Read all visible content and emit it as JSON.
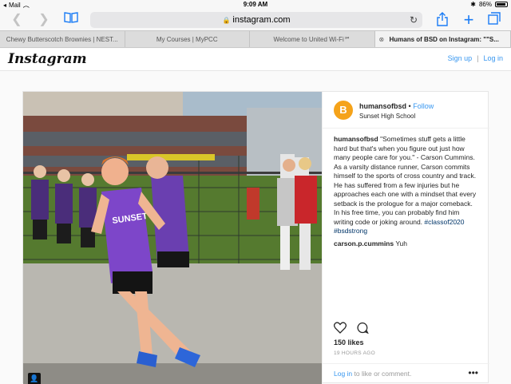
{
  "status": {
    "carrier": "Mail",
    "time": "9:09 AM",
    "battery": "86%"
  },
  "browser": {
    "url": "instagram.com",
    "tabs": [
      {
        "label": "Chewy Butterscotch Brownies | NEST..."
      },
      {
        "label": "My Courses | MyPCC"
      },
      {
        "label": "Welcome to United Wi-Fi℠"
      },
      {
        "label": "Humans of BSD on Instagram: \"\"S..."
      }
    ]
  },
  "header": {
    "logo": "Instagram",
    "signup": "Sign up",
    "separator": "|",
    "login": "Log in"
  },
  "post": {
    "username": "humansofbsd",
    "bullet": "•",
    "follow": "Follow",
    "location": "Sunset High School",
    "caption_user": "humansofbsd",
    "caption_text": " \"Sometimes stuff gets a little hard but that's when you figure out just how many people care for you.\" - Carson Cummins. As a varsity distance runner, Carson commits himself to the sports of cross country and track. He has suffered from a few injuries but he approaches each one with a mindset that every setback is the prologue for a major comeback. In his free time, you can probably find him writing code or joking around. ",
    "hashtag1": "#classof2020",
    "hashtag2": "#bsdstrong",
    "comment_user": "carson.p.cummins",
    "comment_text": " Yuh",
    "likes": "150 likes",
    "time_ago": "19 HOURS AGO",
    "login_link": "Log in",
    "login_rest": " to like or comment.",
    "more": "•••",
    "avatar_letter": "B"
  },
  "colors": {
    "accent": "#3897f0",
    "ios_blue": "#1a7cf5"
  }
}
